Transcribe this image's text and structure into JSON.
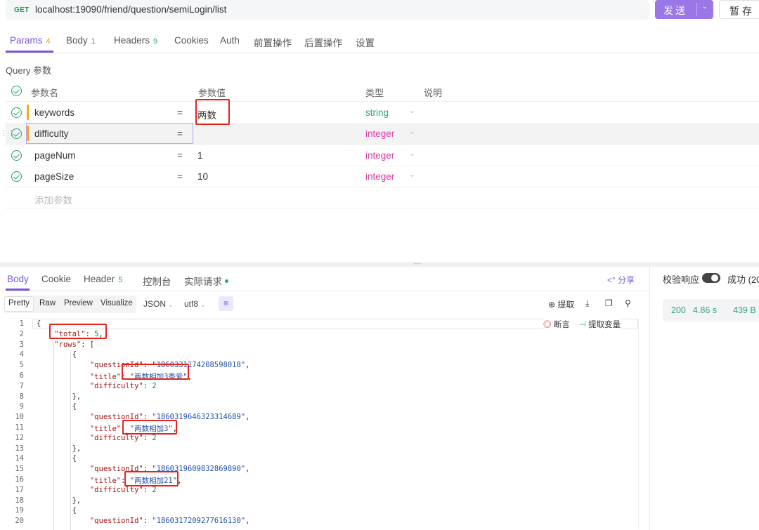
{
  "request": {
    "method": "GET",
    "url": "localhost:19090/friend/question/semiLogin/list",
    "send_label": "发送",
    "save_label": "暂存"
  },
  "request_tabs": [
    {
      "label": "Params",
      "count": "4"
    },
    {
      "label": "Body",
      "count": "1"
    },
    {
      "label": "Headers",
      "count": "9"
    },
    {
      "label": "Cookies",
      "count": ""
    },
    {
      "label": "Auth",
      "count": ""
    },
    {
      "label": "前置操作",
      "count": ""
    },
    {
      "label": "后置操作",
      "count": ""
    },
    {
      "label": "设置",
      "count": ""
    }
  ],
  "query": {
    "title": "Query 参数",
    "headers": {
      "name": "参数名",
      "value": "参数值",
      "type": "类型",
      "desc": "说明"
    },
    "params": [
      {
        "name": "keywords",
        "value": "两数",
        "type": "string"
      },
      {
        "name": "difficulty",
        "value": "",
        "type": "integer"
      },
      {
        "name": "pageNum",
        "value": "1",
        "type": "integer"
      },
      {
        "name": "pageSize",
        "value": "10",
        "type": "integer"
      }
    ],
    "add_placeholder": "添加参数"
  },
  "response_tabs": [
    {
      "label": "Body",
      "count": ""
    },
    {
      "label": "Cookie",
      "count": ""
    },
    {
      "label": "Header",
      "count": "5"
    },
    {
      "label": "控制台",
      "count": ""
    },
    {
      "label": "实际请求",
      "count": ""
    }
  ],
  "share_label": "分享",
  "format_bar": {
    "views": [
      "Pretty",
      "Raw",
      "Preview",
      "Visualize"
    ],
    "format": "JSON",
    "encoding": "utf8",
    "extract_label": "提取"
  },
  "code_tools": {
    "assert": "断言",
    "extract_var": "提取变量"
  },
  "code_lines": [
    "{",
    "    \"total\": 5,",
    "    \"rows\": [",
    "        {",
    "            \"questionId\": \"1860331174208598018\",",
    "            \"title\": \"两数相加3秀爱\",",
    "            \"difficulty\": 2",
    "        },",
    "        {",
    "            \"questionId\": \"1860319646323314689\",",
    "            \"title\": \"两数相加3\",",
    "            \"difficulty\": 2",
    "        },",
    "        {",
    "            \"questionId\": \"1860319609832869890\",",
    "            \"title\": \"两数相加21\",",
    "            \"difficulty\": 2",
    "        },",
    "        {",
    "            \"questionId\": \"1860317209277616130\","
  ],
  "right_panel": {
    "validate_label": "校验响应",
    "status_text": "成功 (20",
    "status_code": "200",
    "time": "4.86 s",
    "size": "439 B"
  },
  "colors": {
    "accent": "#7a55d6",
    "send_button": "#9b76e6",
    "success": "#2fa37a",
    "integer_type": "#d93caa",
    "highlight_box": "#e5231c"
  }
}
